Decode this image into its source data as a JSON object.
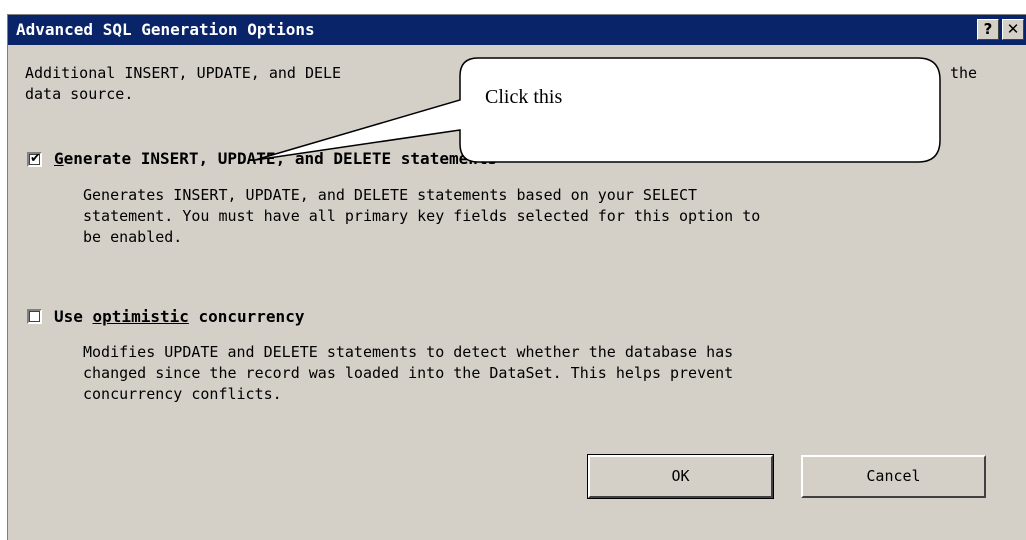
{
  "window": {
    "title": "Advanced SQL Generation Options",
    "help_glyph": "?",
    "close_glyph": "✕"
  },
  "intro": {
    "line1_start": "Additional INSERT, UPDATE, and DELE",
    "line1_end": "the",
    "line2": "data source."
  },
  "options": [
    {
      "checked": true,
      "label_mnemonic": "G",
      "label_rest": "enerate INSERT, UPDATE, and DELETE statements",
      "description": "Generates INSERT, UPDATE, and DELETE statements based on your SELECT\nstatement. You must have all primary key fields selected for this option to\nbe enabled."
    },
    {
      "checked": false,
      "label_before": "Use ",
      "label_mnemonic": "optimistic",
      "label_after": " concurrency",
      "description": "Modifies UPDATE and DELETE statements to detect whether the database has\nchanged since the record was loaded into the DataSet. This helps prevent\nconcurrency conflicts."
    }
  ],
  "buttons": {
    "ok": "OK",
    "cancel": "Cancel"
  },
  "annotation": {
    "callout_text": "Click this"
  },
  "checkmark_glyph": "✔",
  "colors": {
    "titlebar": "#0a246a",
    "dialog_face": "#d4d0c8",
    "title_text": "#ffffff"
  }
}
